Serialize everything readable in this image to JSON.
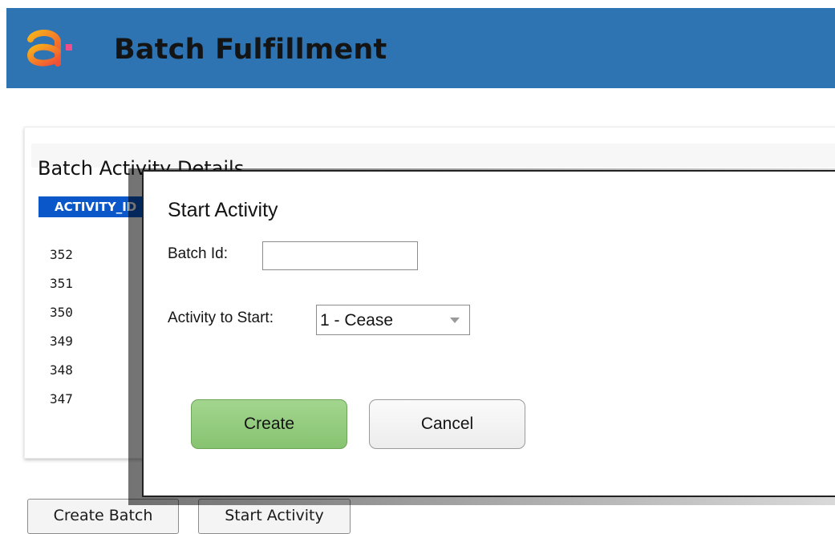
{
  "header": {
    "title": "Batch Fulfillment",
    "logo": "app-logo-icon",
    "background_color": "#2e73b2"
  },
  "panel": {
    "section_title": "Batch Activity Details",
    "column_header": "ACTIVITY_ID",
    "ids": [
      "352",
      "351",
      "350",
      "349",
      "348",
      "347"
    ]
  },
  "bottom_buttons": {
    "create_batch": "Create Batch",
    "start_activity": "Start Activity"
  },
  "dialog": {
    "title": "Start Activity",
    "batch_id_label": "Batch Id:",
    "batch_id_value": "",
    "activity_label": "Activity to Start:",
    "activity_selected": "1 - Cease",
    "create_label": "Create",
    "cancel_label": "Cancel",
    "create_color": "#93cc7e"
  }
}
